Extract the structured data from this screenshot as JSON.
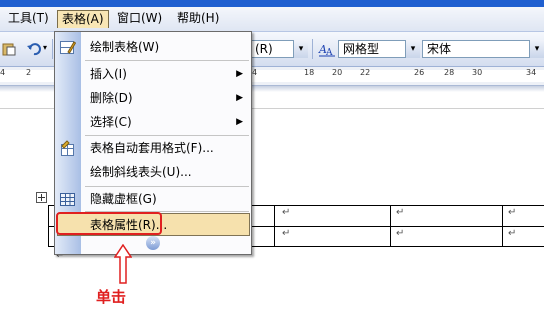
{
  "menubar": {
    "items": [
      {
        "label": "工具(T)"
      },
      {
        "label": "表格(A)"
      },
      {
        "label": "窗口(W)"
      },
      {
        "label": "帮助(H)"
      }
    ]
  },
  "toolbar": {
    "style_partial": "(R)",
    "table_style": "网格型",
    "font": "宋体",
    "undo_icon": "undo-icon",
    "paste_icon": "paste-icon"
  },
  "ruler": {
    "left_ticks": [
      "4",
      "2"
    ],
    "right_ticks": [
      "4",
      "18",
      "20",
      "22",
      "26",
      "28",
      "30",
      "34"
    ]
  },
  "table_menu": {
    "items": [
      {
        "label": "绘制表格(W)",
        "icon": "draw-table-icon"
      },
      {
        "label": "插入(I)",
        "submenu": true
      },
      {
        "label": "删除(D)",
        "submenu": true
      },
      {
        "label": "选择(C)",
        "submenu": true
      },
      {
        "label": "表格自动套用格式(F)...",
        "icon": "autoformat-icon"
      },
      {
        "label": "绘制斜线表头(U)..."
      },
      {
        "label": "隐藏虚框(G)",
        "icon": "gridlines-icon"
      },
      {
        "label": "表格属性(R)...",
        "highlighted": true
      }
    ],
    "expand_icon": "chevron-double-down-icon"
  },
  "document": {
    "cell_mark": "↵",
    "move_handle": "table-move-handle-icon"
  },
  "annotation": {
    "label": "单击",
    "arrow": "up-arrow-icon",
    "highlight_color": "#e02020"
  }
}
